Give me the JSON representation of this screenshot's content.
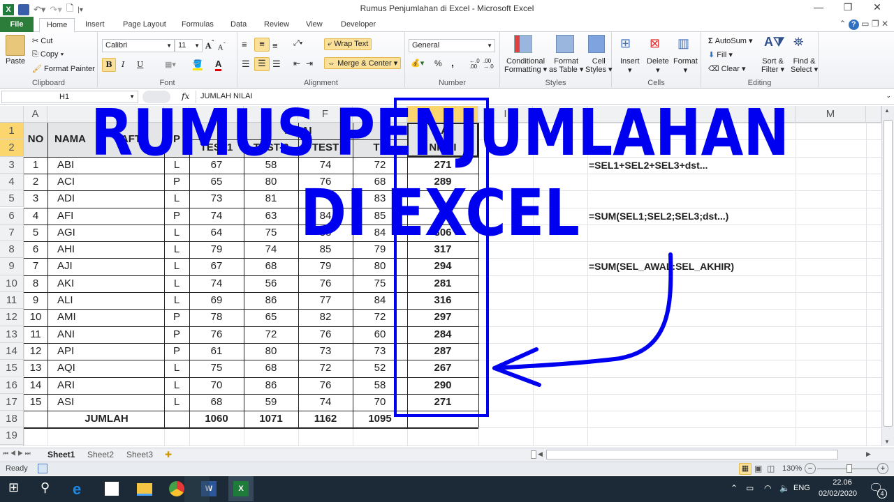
{
  "window": {
    "title": "Rumus Penjumlahan di Excel  -  Microsoft Excel",
    "minimize_icon": "minimize-icon",
    "restore_icon": "restore-icon",
    "close_icon": "close-icon"
  },
  "ribbon_tabs": [
    "File",
    "Home",
    "Insert",
    "Page Layout",
    "Formulas",
    "Data",
    "Review",
    "View",
    "Developer"
  ],
  "ribbon": {
    "clipboard": {
      "paste": "Paste",
      "cut": "Cut",
      "copy": "Copy",
      "format_painter": "Format Painter",
      "label": "Clipboard"
    },
    "font": {
      "name": "Calibri",
      "size": "11",
      "bold": "B",
      "italic": "I",
      "underline": "U",
      "label": "Font"
    },
    "alignment": {
      "wrap_text": "Wrap Text",
      "merge_center": "Merge & Center",
      "label": "Alignment"
    },
    "number": {
      "format": "General",
      "percent": "%",
      "comma": ",",
      "label": "Number"
    },
    "styles": {
      "conditional": "Conditional",
      "conditional2": "Formatting",
      "format_table": "Format",
      "format_table2": "as Table",
      "cell_styles": "Cell",
      "cell_styles2": "Styles",
      "label": "Styles"
    },
    "cells": {
      "insert": "Insert",
      "delete": "Delete",
      "format": "Format",
      "label": "Cells"
    },
    "editing": {
      "autosum": "AutoSum",
      "fill": "Fill",
      "clear": "Clear",
      "sort": "Sort &",
      "sort2": "Filter",
      "find": "Find &",
      "find2": "Select",
      "label": "Editing"
    }
  },
  "formula_bar": {
    "name_box": "H1",
    "fx": "fx",
    "formula": "JUMLAH NILAI"
  },
  "columns": [
    "A",
    "",
    "",
    "",
    "",
    "F",
    "",
    "",
    "I",
    "",
    "",
    "M"
  ],
  "headers": {
    "no": "NO",
    "nama": "NAMA",
    "daftar": "AFT",
    "lp": "P",
    "nilai": "NILAI",
    "test1": "TEST1",
    "test2": "TEST-2",
    "test3": "TEST",
    "test4": "TE",
    "jumlah_nilai_top": "LAI",
    "jumlah_nilai_bottom": "NILAI"
  },
  "rows": [
    {
      "no": "1",
      "nama": "ABI",
      "lp": "L",
      "t1": "67",
      "t2": "58",
      "t3": "74",
      "t4": "72",
      "total": "271"
    },
    {
      "no": "2",
      "nama": "ACI",
      "lp": "P",
      "t1": "65",
      "t2": "80",
      "t3": "76",
      "t4": "68",
      "total": "289"
    },
    {
      "no": "3",
      "nama": "ADI",
      "lp": "L",
      "t1": "73",
      "t2": "81",
      "t3": "",
      "t4": "83",
      "total": ""
    },
    {
      "no": "4",
      "nama": "AFI",
      "lp": "P",
      "t1": "74",
      "t2": "63",
      "t3": "84",
      "t4": "85",
      "total": ""
    },
    {
      "no": "5",
      "nama": "AGI",
      "lp": "L",
      "t1": "64",
      "t2": "75",
      "t3": "83",
      "t4": "84",
      "total": "306"
    },
    {
      "no": "6",
      "nama": "AHI",
      "lp": "L",
      "t1": "79",
      "t2": "74",
      "t3": "85",
      "t4": "79",
      "total": "317"
    },
    {
      "no": "7",
      "nama": "AJI",
      "lp": "L",
      "t1": "67",
      "t2": "68",
      "t3": "79",
      "t4": "80",
      "total": "294"
    },
    {
      "no": "8",
      "nama": "AKI",
      "lp": "L",
      "t1": "74",
      "t2": "56",
      "t3": "76",
      "t4": "75",
      "total": "281"
    },
    {
      "no": "9",
      "nama": "ALI",
      "lp": "L",
      "t1": "69",
      "t2": "86",
      "t3": "77",
      "t4": "84",
      "total": "316"
    },
    {
      "no": "10",
      "nama": "AMI",
      "lp": "P",
      "t1": "78",
      "t2": "65",
      "t3": "82",
      "t4": "72",
      "total": "297"
    },
    {
      "no": "11",
      "nama": "ANI",
      "lp": "P",
      "t1": "76",
      "t2": "72",
      "t3": "76",
      "t4": "60",
      "total": "284"
    },
    {
      "no": "12",
      "nama": "API",
      "lp": "P",
      "t1": "61",
      "t2": "80",
      "t3": "73",
      "t4": "73",
      "total": "287"
    },
    {
      "no": "13",
      "nama": "AQI",
      "lp": "L",
      "t1": "75",
      "t2": "68",
      "t3": "72",
      "t4": "52",
      "total": "267"
    },
    {
      "no": "14",
      "nama": "ARI",
      "lp": "L",
      "t1": "70",
      "t2": "86",
      "t3": "76",
      "t4": "58",
      "total": "290"
    },
    {
      "no": "15",
      "nama": "ASI",
      "lp": "L",
      "t1": "68",
      "t2": "59",
      "t3": "74",
      "t4": "70",
      "total": "271"
    }
  ],
  "totals": {
    "label": "JUMLAH",
    "t1": "1060",
    "t2": "1071",
    "t3": "1162",
    "t4": "1095"
  },
  "formulas": [
    "=SEL1+SEL2+SEL3+dst...",
    "=SUM(SEL1;SEL2;SEL3;dst...)",
    "=SUM(SEL_AWAL:SEL_AKHIR)"
  ],
  "overlay": {
    "line1": "RUMUS PENJUMLAHAN",
    "line2": "DI EXCEL",
    "color": "#0000f0"
  },
  "sheets": [
    "Sheet1",
    "Sheet2",
    "Sheet3"
  ],
  "status": {
    "ready": "Ready",
    "zoom": "130%"
  },
  "taskbar": {
    "lang": "ENG",
    "time": "22.06",
    "date": "02/02/2020",
    "notifications": "4"
  }
}
